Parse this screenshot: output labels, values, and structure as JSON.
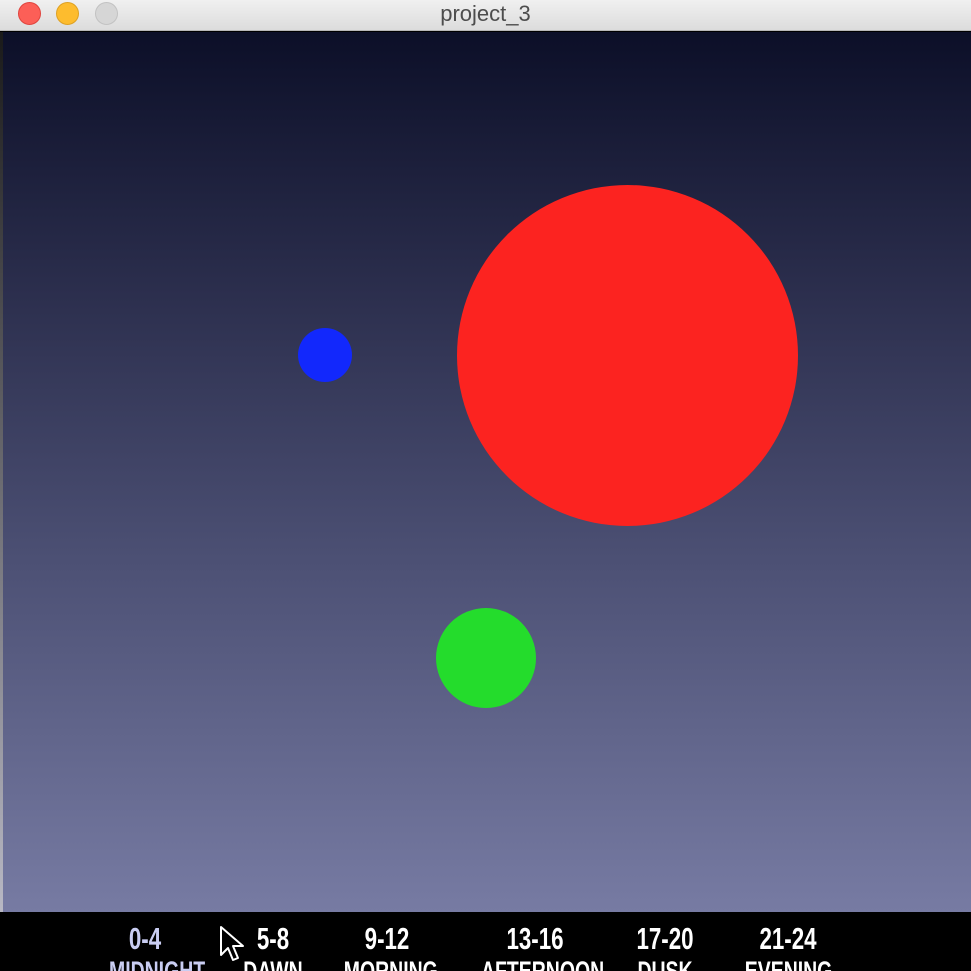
{
  "window": {
    "title": "project_3",
    "controls": {
      "close": "close-button",
      "minimize": "minimize-button",
      "zoom": "zoom-button"
    }
  },
  "scene": {
    "background_top": "#0c0f28",
    "background_bottom": "#777ba3",
    "circles": [
      {
        "name": "red-circle",
        "color": "#fc2320"
      },
      {
        "name": "blue-circle",
        "color": "#1228fc"
      },
      {
        "name": "green-circle",
        "color": "#24dc2c"
      }
    ]
  },
  "time_bar": {
    "slots": [
      {
        "range": "0-4",
        "period": "MIDNIGHT",
        "active": true
      },
      {
        "range": "5-8",
        "period": "DAWN",
        "active": false
      },
      {
        "range": "9-12",
        "period": "MORNING",
        "active": false
      },
      {
        "range": "13-16",
        "period": "AFTERNOON",
        "active": false
      },
      {
        "range": "17-20",
        "period": "DUSK",
        "active": false
      },
      {
        "range": "21-24",
        "period": "EVENING",
        "active": false
      }
    ],
    "active_color": "#c9cdf2",
    "inactive_color": "#ffffff"
  },
  "cursor": {
    "icon": "arrow-cursor-icon"
  }
}
